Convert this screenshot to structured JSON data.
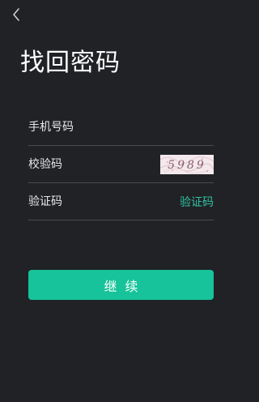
{
  "header": {
    "back_icon": "chevron-left-icon",
    "title": "找回密码"
  },
  "form": {
    "phone": {
      "placeholder": "手机号码",
      "value": ""
    },
    "captcha": {
      "placeholder": "校验码",
      "value": "",
      "image_text": "5989"
    },
    "sms_code": {
      "placeholder": "验证码",
      "value": "",
      "send_label": "验证码"
    }
  },
  "actions": {
    "continue_label": "继续"
  },
  "colors": {
    "background": "#212226",
    "accent": "#16c39a",
    "link": "#2fc3a3",
    "divider": "#4a4b50"
  }
}
